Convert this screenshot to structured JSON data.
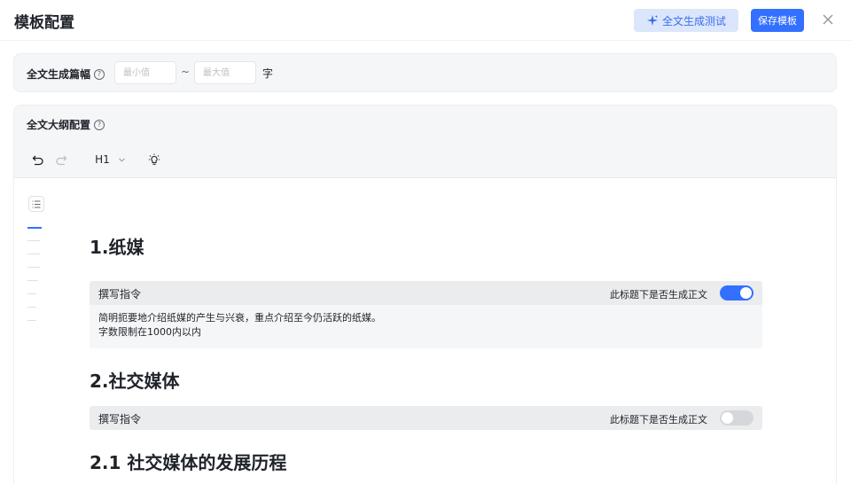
{
  "header": {
    "title": "模板配置",
    "test_button": "全文生成测试",
    "save_button": "保存模板"
  },
  "length": {
    "label": "全文生成篇幅",
    "min_placeholder": "最小值",
    "tilde": "~",
    "max_placeholder": "最大值",
    "unit": "字"
  },
  "outline": {
    "label": "全文大纲配置",
    "toolbar": {
      "heading_level": "H1"
    },
    "sections": [
      {
        "heading": "1.纸媒",
        "instruction_label": "撰写指令",
        "toggle_label": "此标题下是否生成正文",
        "toggle_on": true,
        "body_lines": [
          "简明扼要地介绍纸媒的产生与兴衰，重点介绍至今仍活跃的纸媒。",
          "字数限制在1000内以内"
        ]
      },
      {
        "heading": "2.社交媒体",
        "instruction_label": "撰写指令",
        "toggle_label": "此标题下是否生成正文",
        "toggle_on": false
      },
      {
        "heading": "2.1 社交媒体的发展历程"
      }
    ]
  },
  "colors": {
    "primary": "#3370ff",
    "test_button_bg": "#dbe6fd"
  }
}
